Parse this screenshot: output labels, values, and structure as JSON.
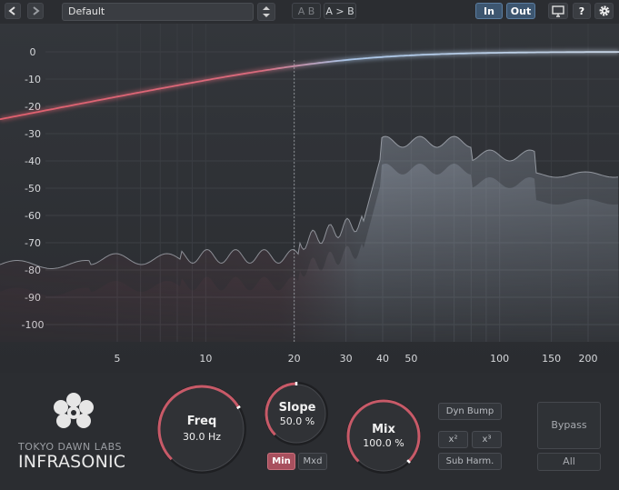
{
  "toolbar": {
    "back_icon": "arrow-left-icon",
    "forward_icon": "arrow-right-icon",
    "preset_name": "Default",
    "ab_label": "A B",
    "a_to_b_label": "A > B",
    "in_label": "In",
    "out_label": "Out",
    "screen_icon": "monitor-icon",
    "help_label": "?",
    "settings_icon": "gear-icon"
  },
  "graph": {
    "y_ticks": [
      "0",
      "-10",
      "-20",
      "-30",
      "-40",
      "-50",
      "-60",
      "-70",
      "-80",
      "-90",
      "-100"
    ],
    "x_ticks": [
      "5",
      "10",
      "20",
      "30",
      "40",
      "50",
      "100",
      "150",
      "200"
    ],
    "curve_color_low": "#e0606e",
    "curve_color_high": "#a8c4e6"
  },
  "controls": {
    "freq": {
      "title": "Freq",
      "value": "30.0 Hz",
      "fraction": 0.72
    },
    "slope": {
      "title": "Slope",
      "value": "50.0 %",
      "fraction": 0.5
    },
    "mix": {
      "title": "Mix",
      "value": "100.0 %",
      "fraction": 1.0
    },
    "mode_min": "Min",
    "mode_mxd": "Mxd",
    "dyn_bump": "Dyn Bump",
    "x2": "x²",
    "x3": "x³",
    "sub_harm": "Sub Harm.",
    "bypass": "Bypass",
    "all": "All"
  },
  "brand": {
    "company": "TOKYO DAWN LABS",
    "product": "INFRASONIC",
    "logo_icon": "flower-logo-icon"
  },
  "colors": {
    "accent": "#c85a68",
    "active_blue": "#3d5670"
  }
}
